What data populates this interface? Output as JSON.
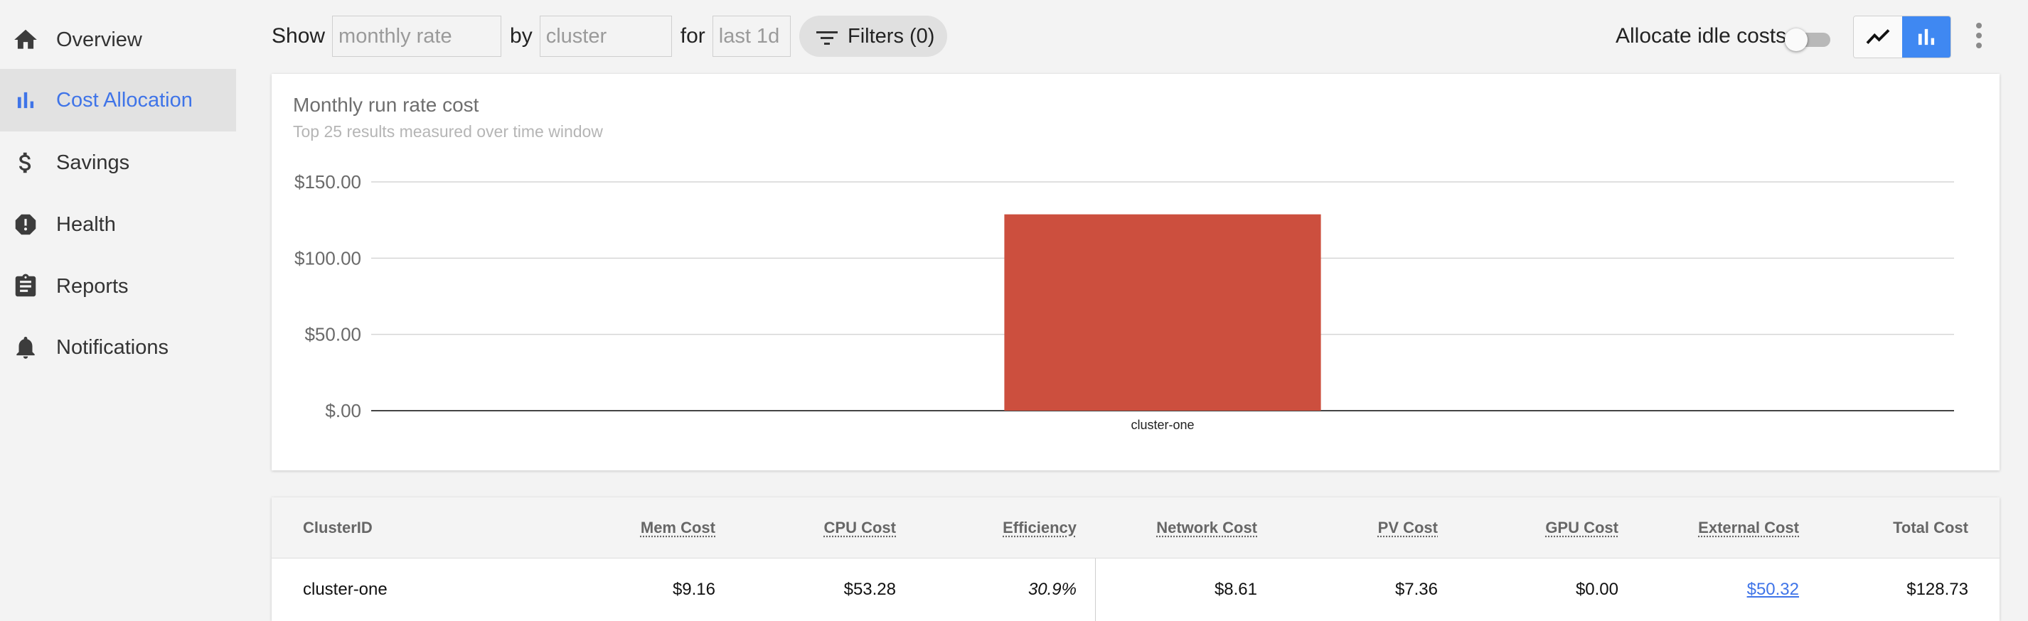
{
  "sidebar": {
    "items": [
      {
        "label": "Overview",
        "icon": "home-icon",
        "active": false
      },
      {
        "label": "Cost Allocation",
        "icon": "bar-chart-icon",
        "active": true
      },
      {
        "label": "Savings",
        "icon": "dollar-icon",
        "active": false
      },
      {
        "label": "Health",
        "icon": "alert-icon",
        "active": false
      },
      {
        "label": "Reports",
        "icon": "clipboard-icon",
        "active": false
      },
      {
        "label": "Notifications",
        "icon": "bell-icon",
        "active": false
      }
    ]
  },
  "toolbar": {
    "show_label": "Show",
    "show_value": "monthly rate",
    "by_label": "by",
    "by_value": "cluster",
    "for_label": "for",
    "for_value": "last 1d",
    "filters_label": "Filters (0)",
    "idle_label": "Allocate idle costs",
    "idle_enabled": false,
    "view_mode": "bar"
  },
  "chart": {
    "title": "Monthly run rate cost",
    "subtitle": "Top 25 results measured over time window"
  },
  "chart_data": {
    "type": "bar",
    "categories": [
      "cluster-one"
    ],
    "values": [
      128.73
    ],
    "ylim": [
      0,
      150
    ],
    "yticks": [
      0,
      50,
      100,
      150
    ],
    "ytick_labels": [
      "$.00",
      "$50.00",
      "$100.00",
      "$150.00"
    ],
    "bar_color": "#cc4f3e",
    "grid": true
  },
  "table": {
    "columns": [
      {
        "label": "ClusterID",
        "sortable": false
      },
      {
        "label": "Mem Cost",
        "sortable": true
      },
      {
        "label": "CPU Cost",
        "sortable": true
      },
      {
        "label": "Efficiency",
        "sortable": true
      },
      {
        "label": "Network Cost",
        "sortable": true
      },
      {
        "label": "PV Cost",
        "sortable": true
      },
      {
        "label": "GPU Cost",
        "sortable": true
      },
      {
        "label": "External Cost",
        "sortable": true
      },
      {
        "label": "Total Cost",
        "sortable": false
      }
    ],
    "rows": [
      {
        "cluster_id": "cluster-one",
        "mem_cost": "$9.16",
        "cpu_cost": "$53.28",
        "efficiency": "30.9%",
        "network_cost": "$8.61",
        "pv_cost": "$7.36",
        "gpu_cost": "$0.00",
        "external_cost": "$50.32",
        "total_cost": "$128.73"
      }
    ]
  },
  "colors": {
    "accent": "#3f74e8",
    "bar": "#cc4f3e",
    "toggle_active": "#3f88f2"
  }
}
